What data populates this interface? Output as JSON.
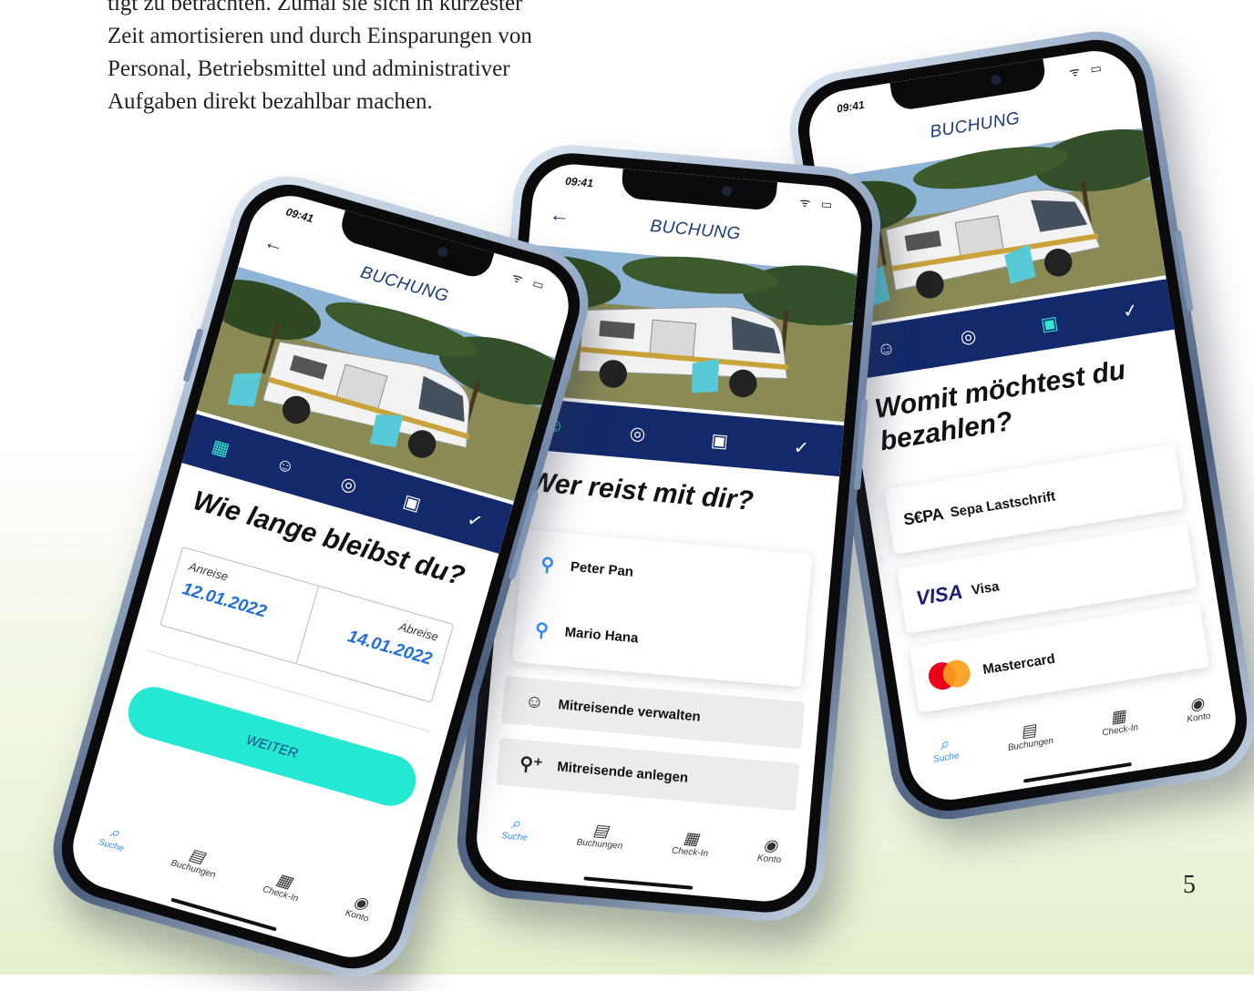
{
  "intro_lines": [
    "tigt zu betrachten. Zumal sie sich in kürzester",
    "Zeit amortisieren und durch Einsparungen von",
    "Personal, Betriebsmittel und administrativer",
    "Aufgaben direkt bezahlbar machen."
  ],
  "page_number": "5",
  "app": {
    "time": "09:41",
    "title": "BUCHUNG",
    "nav": {
      "search": "Suche",
      "bookings": "Buchungen",
      "checkin": "Check-In",
      "account": "Konto"
    }
  },
  "phone1": {
    "heading": "Wie lange bleibst du?",
    "arrival_label": "Anreise",
    "arrival_value": "12.01.2022",
    "departure_label": "Abreise",
    "departure_value": "14.01.2022",
    "button": "WEITER"
  },
  "phone2": {
    "heading": "Wer reist mit dir?",
    "people": [
      "Peter Pan",
      "Mario Hana"
    ],
    "manage": "Mitreisende verwalten",
    "create": "Mitreisende anlegen"
  },
  "phone3": {
    "heading": "Womit möchtest du bezahlen?",
    "sepa_logo": "S€PA",
    "sepa_label": "Sepa Lastschrift",
    "visa_logo": "VISA",
    "visa_label": "Visa",
    "mastercard_label": "Mastercard"
  },
  "colors": {
    "navy": "#13296b",
    "accent": "#24e8d1",
    "blue": "#2f8cff"
  }
}
